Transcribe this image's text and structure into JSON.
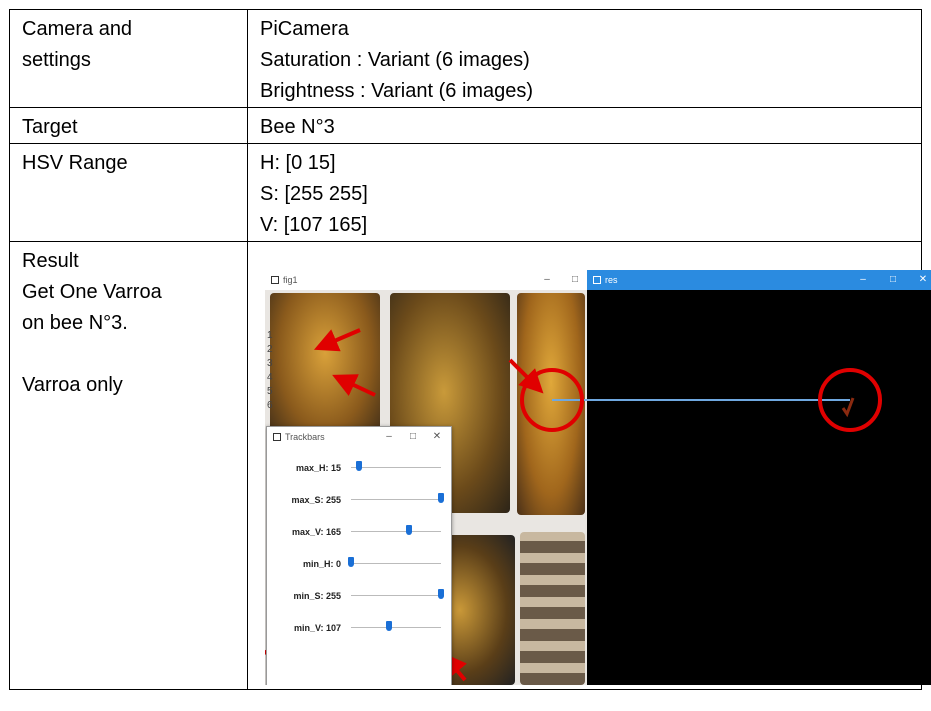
{
  "rows": [
    {
      "label": [
        "Camera and",
        "settings"
      ],
      "value": [
        "PiCamera",
        "Saturation : Variant (6 images)",
        "Brightness : Variant (6 images)"
      ]
    },
    {
      "label": [
        "Target"
      ],
      "value": [
        "Bee N°3"
      ]
    },
    {
      "label": [
        "HSV Range"
      ],
      "value": [
        "H: [0  15]",
        "S: [255 255]",
        "V: [107  165]"
      ]
    }
  ],
  "result": {
    "label_lines": [
      "Result",
      "Get One Varroa",
      "on bee N°3.",
      "",
      "Varroa only"
    ]
  },
  "screenshot": {
    "fig1_window": {
      "title": "fig1",
      "row_numbers": [
        "1",
        "2",
        "3",
        "4",
        "5",
        "6"
      ]
    },
    "result_window": {
      "title": "res"
    },
    "trackbars_window": {
      "title": "Trackbars",
      "sliders": [
        {
          "label": "max_H: 15",
          "value": 15,
          "max": 179
        },
        {
          "label": "max_S: 255",
          "value": 255,
          "max": 255
        },
        {
          "label": "max_V: 165",
          "value": 165,
          "max": 255
        },
        {
          "label": "min_H: 0",
          "value": 0,
          "max": 179
        },
        {
          "label": "min_S: 255",
          "value": 255,
          "max": 255
        },
        {
          "label": "min_V: 107",
          "value": 107,
          "max": 255
        }
      ]
    },
    "window_controls": {
      "minimize": "–",
      "maximize": "□",
      "close": "✕"
    },
    "colors": {
      "accent_blue": "#2b8be0",
      "marker_red": "#e00000",
      "line_blue": "#6fa8e0"
    }
  }
}
